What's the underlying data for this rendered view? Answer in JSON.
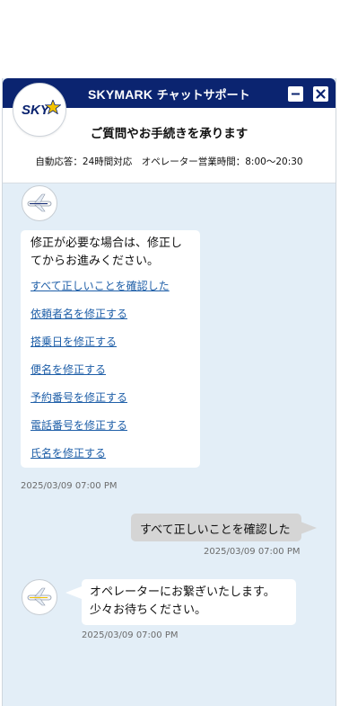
{
  "header": {
    "brand": "SKYMARK",
    "title_suffix": " チャットサポート",
    "minimize_icon": "minimize-icon",
    "close_icon": "close-icon"
  },
  "logo": {
    "text": "SKY",
    "icon": "star-icon"
  },
  "subheader": {
    "title": "ご質問やお手続きを承ります",
    "hours": "自動応答：24時間対応　オペレーター営業時間：8:00〜20:30"
  },
  "messages": {
    "operator_1": {
      "text": "修正が必要な場合は、修正してからお進みください。",
      "choices": [
        "すべて正しいことを確認した",
        "依頼者名を修正する",
        "搭乗日を修正する",
        "便名を修正する",
        "予約番号を修正する",
        "電話番号を修正する",
        "氏名を修正する"
      ],
      "timestamp": "2025/03/09 07:00 PM"
    },
    "user_1": {
      "text": "すべて正しいことを確認した",
      "timestamp": "2025/03/09 07:00 PM"
    },
    "operator_2": {
      "line1": "オペレーターにお繋ぎいたします。",
      "line2": "少々お待ちください。",
      "timestamp": "2025/03/09 07:00 PM"
    }
  },
  "colors": {
    "header": "#0b2470",
    "chat_background": "#e3eef7",
    "link": "#1f5fa8",
    "user_bubble": "#d5d5d5",
    "logo_star": "#f2c200"
  }
}
